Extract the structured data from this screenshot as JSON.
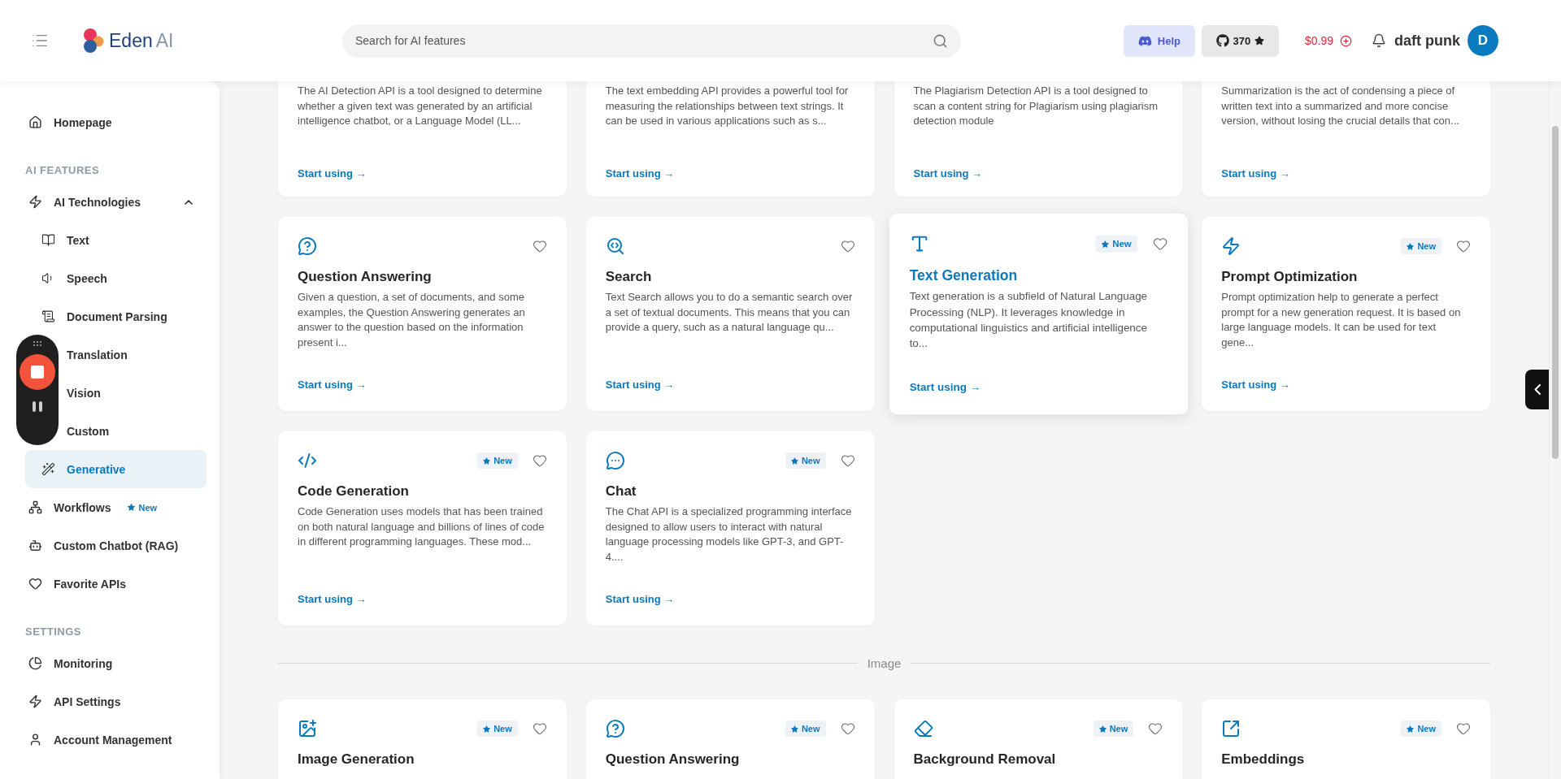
{
  "header": {
    "logo_name": "Eden",
    "logo_suffix": "AI",
    "search": {
      "placeholder": "Search for AI features"
    },
    "help_button": "Help",
    "github_stars": "370",
    "credit": "$0.99",
    "user_name": "daft punk",
    "avatar_initial": "D"
  },
  "sidebar": {
    "items": [
      {
        "kind": "link",
        "label": "Homepage",
        "selected": false
      },
      {
        "kind": "section",
        "label": "AI FEATURES"
      },
      {
        "kind": "group",
        "label": "AI Technologies",
        "expanded": true,
        "children": [
          {
            "label": "Text",
            "selected": false
          },
          {
            "label": "Speech",
            "selected": false
          },
          {
            "label": "Document Parsing",
            "selected": false
          },
          {
            "label": "Translation",
            "selected": false
          },
          {
            "label": "Vision",
            "selected": false
          },
          {
            "label": "Custom",
            "selected": false
          },
          {
            "label": "Generative",
            "selected": true
          }
        ]
      },
      {
        "kind": "link",
        "label": "Workflows",
        "badge": "New",
        "selected": false
      },
      {
        "kind": "link",
        "label": "Custom Chatbot (RAG)",
        "selected": false
      },
      {
        "kind": "link",
        "label": "Favorite APIs",
        "selected": false
      },
      {
        "kind": "section",
        "label": "SETTINGS"
      },
      {
        "kind": "link",
        "label": "Monitoring",
        "selected": false
      },
      {
        "kind": "link",
        "label": "API Settings",
        "selected": false
      },
      {
        "kind": "link",
        "label": "Account Management",
        "selected": false
      }
    ]
  },
  "sections": [
    {
      "cards": [
        {
          "kind": "partial",
          "description": "The AI Detection API is a tool designed to determine whether a given text was generated by an artificial intelligence chatbot, or a Language Model (LL...",
          "link": "Start using →"
        },
        {
          "kind": "partial",
          "description": "The text embedding API provides a powerful tool for measuring the relationships between text strings. It can be used in various applications such as s...",
          "link": "Start using →"
        },
        {
          "kind": "partial",
          "description": "The Plagiarism Detection API is a tool designed to scan a content string for Plagiarism using plagiarism detection module",
          "link": "Start using →"
        },
        {
          "kind": "partial",
          "description": "Summarization is the act of condensing a piece of written text into a summarized and more concise version, without losing the crucial details that con...",
          "link": "Start using →"
        },
        {
          "kind": "full",
          "title": "Question Answering",
          "new": false,
          "favorite": false,
          "selected": false,
          "description": "Given a question, a set of documents, and some examples, the Question Answering generates an answer to the question based on the information present i...",
          "link": "Start using →"
        },
        {
          "kind": "full",
          "title": "Search",
          "new": false,
          "favorite": false,
          "selected": false,
          "description": "Text Search allows you to do a semantic search over a set of textual documents. This means that you can provide a query, such as a natural language qu...",
          "link": "Start using →"
        },
        {
          "kind": "full",
          "title": "Text Generation",
          "new": true,
          "badge": "New",
          "favorite": false,
          "selected": true,
          "description": "Text generation is a subfield of Natural Language Processing (NLP). It leverages knowledge in computational linguistics and artificial intelligence to...",
          "link": "Start using →"
        },
        {
          "kind": "full",
          "title": "Prompt Optimization",
          "new": true,
          "badge": "New",
          "favorite": false,
          "selected": false,
          "description": "Prompt optimization help to generate a perfect prompt for a new generation request. It is based on large language models. It can be used for text gene...",
          "link": "Start using →"
        },
        {
          "kind": "full",
          "title": "Code Generation",
          "new": true,
          "badge": "New",
          "favorite": false,
          "selected": false,
          "description": "Code Generation uses models that has been trained on both natural language and billions of lines of code in different programming languages. These mod...",
          "link": "Start using →"
        },
        {
          "kind": "full",
          "title": "Chat",
          "new": true,
          "badge": "New",
          "favorite": false,
          "selected": false,
          "description": "The Chat API is a specialized programming interface designed to allow users to interact with natural language processing models like GPT-3, and GPT-4....",
          "link": "Start using →"
        }
      ]
    },
    {
      "divider": "Image",
      "cards": [
        {
          "kind": "full",
          "title": "Image Generation",
          "new": true,
          "badge": "New",
          "favorite": false,
          "selected": false
        },
        {
          "kind": "full",
          "title": "Question Answering",
          "new": true,
          "badge": "New",
          "favorite": false,
          "selected": false
        },
        {
          "kind": "full",
          "title": "Background Removal",
          "new": true,
          "badge": "New",
          "favorite": false,
          "selected": false
        },
        {
          "kind": "full",
          "title": "Embeddings",
          "new": true,
          "badge": "New",
          "favorite": false,
          "selected": false
        }
      ]
    }
  ]
}
